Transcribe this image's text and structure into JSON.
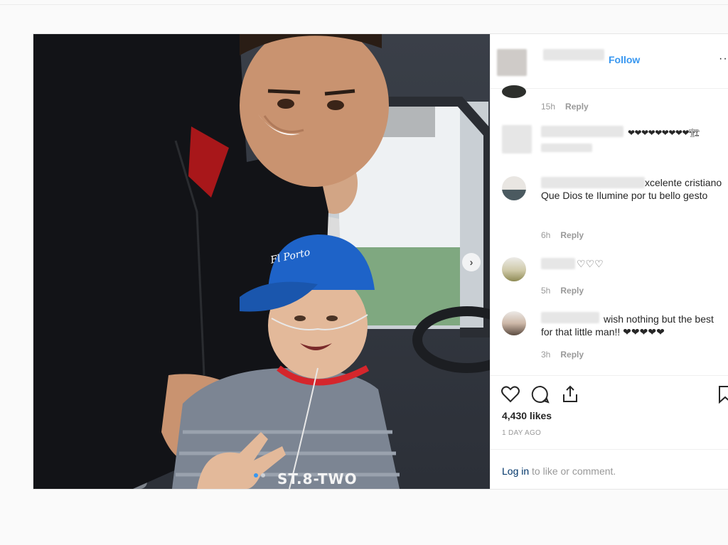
{
  "header": {
    "follow_label": "Follow",
    "more_label": "···"
  },
  "comments": [
    {
      "text": "",
      "time": "15h",
      "reply": "Reply"
    },
    {
      "text": "❤❤❤❤❤❤❤❤❤🏗",
      "time": "",
      "reply": ""
    },
    {
      "text": "xcelente cristiano Que Dios te Ilumine por tu bello gesto",
      "time": "6h",
      "reply": "Reply"
    },
    {
      "text": "♡♡♡",
      "time": "5h",
      "reply": "Reply"
    },
    {
      "text": "wish nothing but the best for that little man!! ❤❤❤❤❤",
      "time": "3h",
      "reply": "Reply"
    }
  ],
  "post": {
    "likes": "4,430 likes",
    "age": "1 DAY AGO",
    "cap_text": "Fl Porto",
    "shirt_text": "ST.8-TWO"
  },
  "footer": {
    "login_link": "Log in",
    "login_rest": " to like or comment."
  },
  "icons": [
    "heart-icon",
    "comment-icon",
    "share-icon",
    "bookmark-icon",
    "chevron-right-icon"
  ],
  "colors": {
    "accent": "#3897f0",
    "link": "#003569",
    "muted": "#999999"
  },
  "carousel": {
    "slides": 2,
    "active_index": 0
  }
}
